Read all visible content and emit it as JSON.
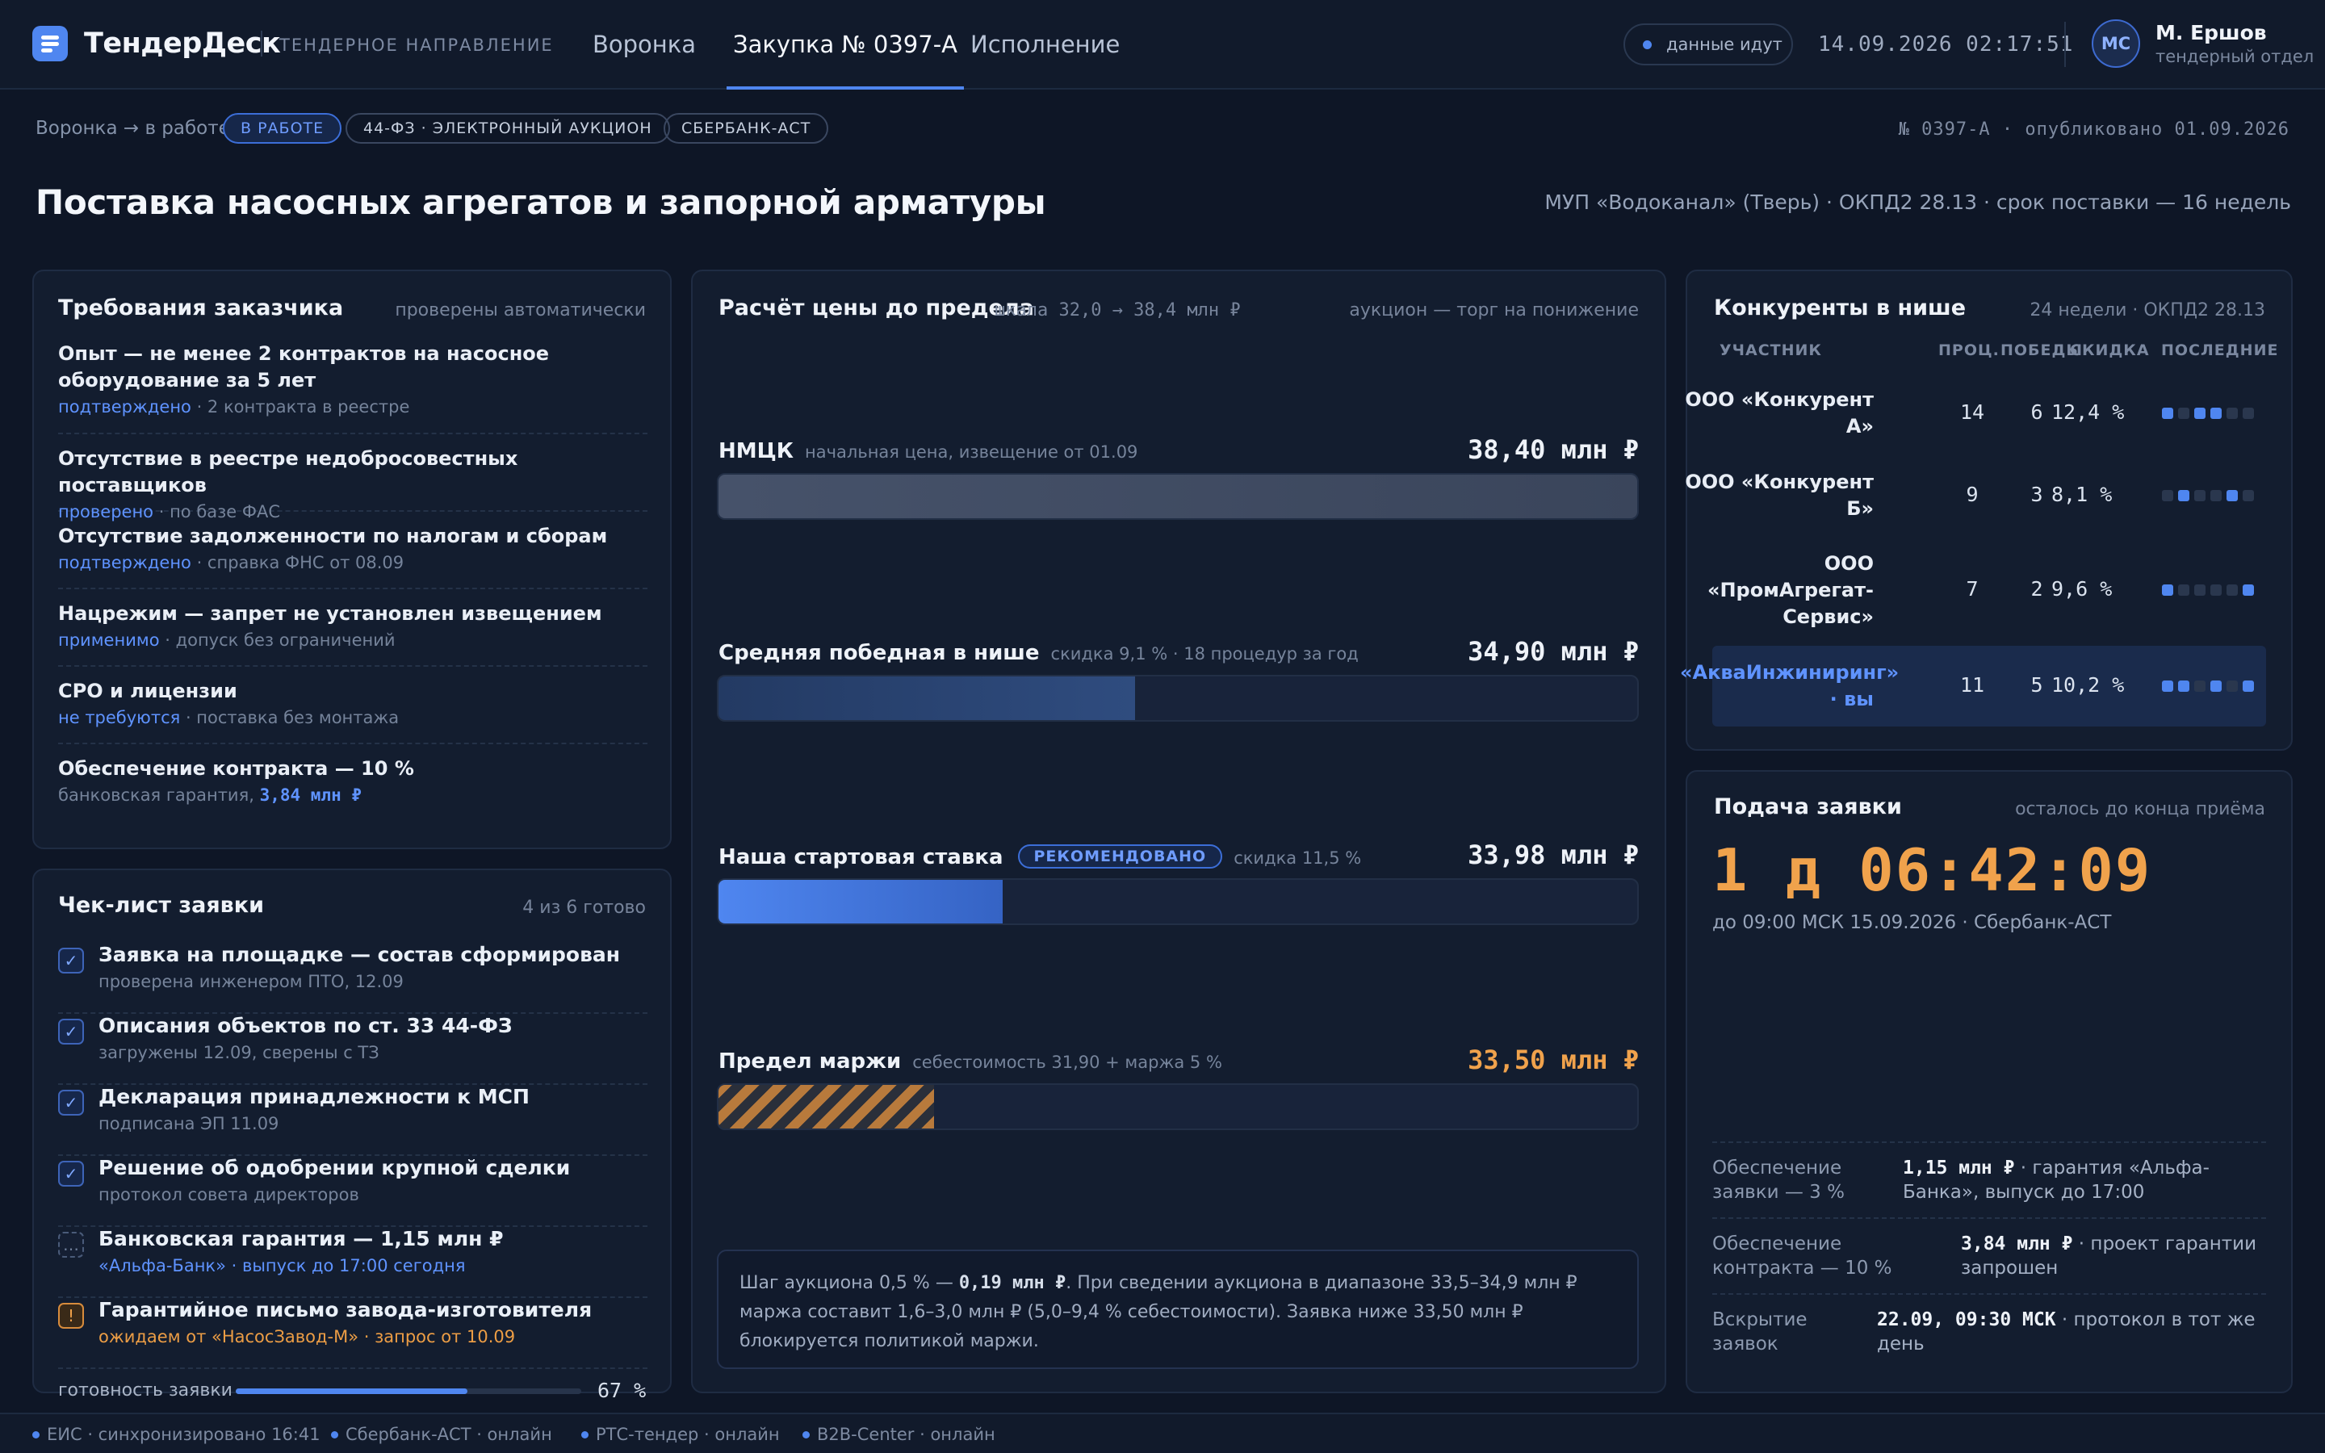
{
  "header": {
    "brand": "ТендерДеск",
    "brand_sub": "ТЕНДЕРНОЕ НАПРАВЛЕНИЕ",
    "tabs": [
      {
        "label": "Воронка"
      },
      {
        "label": "Закупка № 0397-А",
        "active": true
      },
      {
        "label": "Исполнение"
      }
    ],
    "live_status": "данные идут",
    "datetime": "14.09.2026 02:17:51",
    "user": {
      "initials": "МС",
      "name": "М. Ершов",
      "dept": "тендерный отдел"
    }
  },
  "subbar": {
    "breadcrumb": "Воронка → в работе",
    "badges": [
      "В РАБОТЕ",
      "44-ФЗ · ЭЛЕКТРОННЫЙ АУКЦИОН",
      "СБЕРБАНК-АСТ"
    ],
    "pub_info": "№ 0397-А · опубликовано 01.09.2026"
  },
  "page": {
    "title": "Поставка насосных агрегатов и запорной арматуры",
    "meta": "МУП «Водоканал» (Тверь) · ОКПД2 28.13 · срок поставки — 16 недель"
  },
  "requirements": {
    "title": "Требования заказчика",
    "note": "проверены автоматически",
    "items": [
      {
        "title": "Опыт — не менее 2 контрактов на насосное оборудование за 5 лет",
        "status": "подтверждено",
        "detail": " · 2 контракта в реестре"
      },
      {
        "title": "Отсутствие в реестре недобросовестных поставщиков",
        "status": "проверено",
        "detail": " · по базе ФАС"
      },
      {
        "title": "Отсутствие задолженности по налогам и сборам",
        "status": "подтверждено",
        "detail": " · справка ФНС от 08.09"
      },
      {
        "title": "Нацрежим — запрет не установлен извещением",
        "status": "применимо",
        "detail": " · допуск без ограничений"
      },
      {
        "title": "СРО и лицензии",
        "status": "не требуются",
        "detail": " · поставка без монтажа"
      },
      {
        "title": "Обеспечение контракта — 10 %",
        "status": "",
        "detail": "банковская гарантия, ",
        "amount": "3,84 млн ₽"
      }
    ]
  },
  "checklist": {
    "title": "Чек-лист заявки",
    "note": "4 из 6 готово",
    "items": [
      {
        "title": "Заявка на площадке — состав сформирован",
        "sub": "проверена инженером ПТО, 12.09",
        "state": "done",
        "mark": "✓"
      },
      {
        "title": "Описания объектов по ст. 33 44-ФЗ",
        "sub": "загружены 12.09, сверены с ТЗ",
        "state": "done",
        "mark": "✓"
      },
      {
        "title": "Декларация принадлежности к МСП",
        "sub": "подписана ЭП 11.09",
        "state": "done",
        "mark": "✓"
      },
      {
        "title": "Решение об одобрении крупной сделки",
        "sub": "протокол совета директоров",
        "state": "done",
        "mark": "✓"
      },
      {
        "title": "Банковская гарантия — 1,15 млн ₽",
        "sub": "«Альфа-Банк» · выпуск до 17:00 сегодня",
        "state": "pending",
        "mark": "…"
      },
      {
        "title": "Гарантийное письмо завода-изготовителя",
        "sub": "ожидаем от «НасосЗавод-М» · запрос от 10.09",
        "state": "warning",
        "mark": "!"
      }
    ],
    "progress_label": "готовность заявки",
    "progress_value": 67,
    "progress_text": "67 %"
  },
  "pricing": {
    "title": "Расчёт цены до предела",
    "scale": "шкала 32,0 → 38,4 млн ₽",
    "note": "аукцион — торг на понижение",
    "scale_min": 32.0,
    "scale_max": 38.4,
    "rows": [
      {
        "label": "НМЦК",
        "sub": "начальная цена, извещение от 01.09",
        "value": 38.4,
        "value_text": "38,40 млн ₽",
        "style": "gray"
      },
      {
        "label": "Средняя победная в нише",
        "sub": "скидка 9,1 % · 18 процедур за год",
        "value": 34.9,
        "value_text": "34,90 млн ₽",
        "style": "navy"
      },
      {
        "label": "Наша стартовая ставка",
        "badge": "РЕКОМЕНДОВАНО",
        "sub": "скидка 11,5 %",
        "value": 33.98,
        "value_text": "33,98 млн ₽",
        "style": "blue"
      },
      {
        "label": "Предел маржи",
        "sub": "себестоимость 31,90 + маржа 5 %",
        "value": 33.5,
        "value_text": "33,50 млн ₽",
        "style": "hatch"
      }
    ],
    "info": {
      "p1": "Шаг аукциона 0,5 % — ",
      "p1b": "0,19 млн ₽",
      "p2": ". При сведении аукциона в диапазоне 33,5–34,9 млн ₽ маржа составит 1,6–3,0 млн ₽ (5,0–9,4 % себестоимости). Заявка ниже 33,50 млн ₽ блокируется политикой маржи."
    }
  },
  "competitors": {
    "title": "Конкуренты в нише",
    "note": "24 недели · ОКПД2 28.13",
    "columns": [
      "УЧАСТНИК",
      "ПРОЦ.",
      "ПОБЕДЫ",
      "СКИДКА",
      "ПОСЛЕДНИЕ"
    ],
    "rows": [
      {
        "name": "ООО «Конкурент А»",
        "procs": "14",
        "wins": "6",
        "discount": "12,4 %",
        "recent": [
          1,
          0,
          1,
          1,
          0,
          0
        ]
      },
      {
        "name": "ООО «Конкурент Б»",
        "procs": "9",
        "wins": "3",
        "discount": "8,1 %",
        "recent": [
          0,
          1,
          0,
          0,
          1,
          0
        ]
      },
      {
        "name": "ООО «ПромАгрегат-Сервис»",
        "procs": "7",
        "wins": "2",
        "discount": "9,6 %",
        "recent": [
          1,
          0,
          0,
          0,
          0,
          1
        ]
      },
      {
        "name": "«АкваИнжиниринг» · вы",
        "procs": "11",
        "wins": "5",
        "discount": "10,2 %",
        "recent": [
          1,
          1,
          0,
          1,
          0,
          1
        ],
        "self": true
      }
    ]
  },
  "submission": {
    "title": "Подача заявки",
    "note": "осталось до конца приёма",
    "countdown": "1 д 06:42:09",
    "deadline": "до 09:00 МСК 15.09.2026 · Сбербанк-АСТ",
    "rows": [
      {
        "key": "Обеспечение заявки — 3 %",
        "value": "1,15 млн ₽",
        "rest": " · гарантия «Альфа-Банка», выпуск до 17:00"
      },
      {
        "key": "Обеспечение контракта — 10 %",
        "value": "3,84 млн ₽",
        "rest": " · проект гарантии запрошен"
      },
      {
        "key": "Вскрытие заявок",
        "value": "22.09, 09:30 МСК",
        "rest": " · протокол в тот же день"
      }
    ]
  },
  "footer": [
    "ЕИС · синхронизировано 16:41",
    "Сбербанк-АСТ · онлайн",
    "РТС-тендер · онлайн",
    "B2B-Center · онлайн"
  ],
  "colors": {
    "accent": "#4f86f0",
    "warning": "#f0a24c",
    "background": "#0e1626",
    "panel": "#131d2f"
  }
}
